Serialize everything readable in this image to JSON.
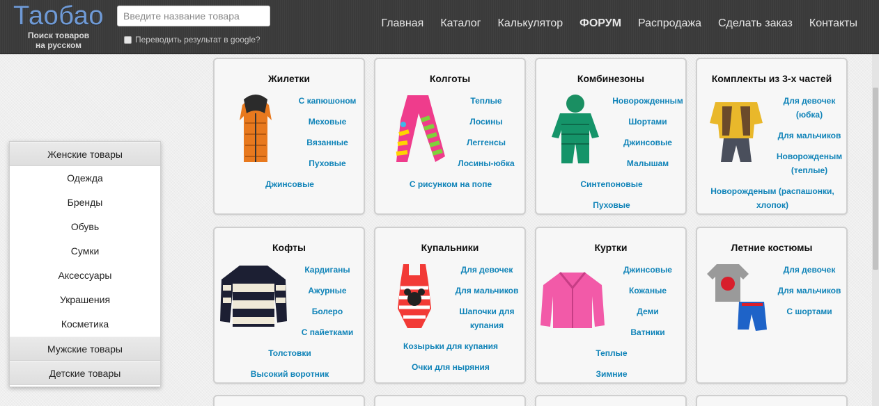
{
  "header": {
    "logo": "Таобао",
    "logo_sub1": "Поиск товаров",
    "logo_sub2": "на русском",
    "search_placeholder": "Введите название товара",
    "translate_label": "Переводить результат в google?",
    "nav": [
      "Главная",
      "Каталог",
      "Калькулятор",
      "ФОРУМ",
      "Распродажа",
      "Сделать заказ",
      "Контакты"
    ]
  },
  "sidebar": {
    "items": [
      "Женские товары",
      "Одежда",
      "Бренды",
      "Обувь",
      "Сумки",
      "Аксессуары",
      "Украшения",
      "Косметика",
      "Мужские товары",
      "Детские товары"
    ]
  },
  "cards": [
    {
      "title": "Жилетки",
      "links": [
        "С капюшоном",
        "Меховые",
        "Вязанные",
        "Пуховые",
        "Джинсовые"
      ]
    },
    {
      "title": "Колготы",
      "links": [
        "Теплые",
        "Лосины",
        "Леггенсы",
        "Лосины-юбка",
        "С рисунком на попе"
      ]
    },
    {
      "title": "Комбинезоны",
      "links": [
        "Новорожденным",
        "Шортами",
        "Джинсовые",
        "Малышам",
        "Синтепоновые",
        "Пуховые"
      ]
    },
    {
      "title": "Комплекты из 3-х частей",
      "links": [
        "Для девочек (юбка)",
        "Для мальчиков",
        "Новорожденым (теплые)",
        "Новорожденым (распашонки, хлопок)"
      ]
    },
    {
      "title": "Кофты",
      "links": [
        "Кардиганы",
        "Ажурные",
        "Болеро",
        "С пайетками",
        "Толстовки",
        "Высокий воротник"
      ]
    },
    {
      "title": "Купальники",
      "links": [
        "Для девочек",
        "Для мальчиков",
        "Шапочки для купания",
        "Козырьки для купания",
        "Очки для ныряния"
      ]
    },
    {
      "title": "Куртки",
      "links": [
        "Джинсовые",
        "Кожаные",
        "Деми",
        "Ватники",
        "Теплые",
        "Зимние"
      ]
    },
    {
      "title": "Летние костюмы",
      "links": [
        "Для девочек",
        "Для мальчиков",
        "С шортами"
      ]
    }
  ],
  "colors": {
    "link": "#0f83b8",
    "header_bg": "#3a3a3a",
    "logo": "#6f9ad6"
  }
}
